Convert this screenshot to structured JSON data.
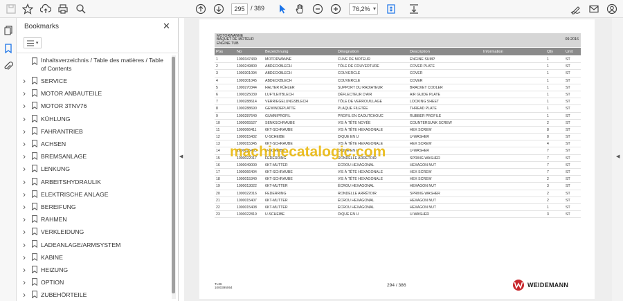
{
  "toolbar": {
    "page_current": "295",
    "page_total": "/ 389",
    "zoom": "76,2%",
    "icons": [
      "save-icon",
      "bookmark-star-icon",
      "upload-icon",
      "print-icon",
      "zoom-search-icon",
      "page-up-icon",
      "page-down-icon",
      "select-cursor-icon",
      "hand-icon",
      "zoom-out-icon",
      "zoom-in-icon",
      "fit-page-icon",
      "scroll-mode-icon",
      "sign-icon",
      "mail-icon",
      "account-icon"
    ]
  },
  "panel": {
    "title": "Bookmarks",
    "close": "✕",
    "bookmarks": [
      {
        "label": "Inhaltsverzeichnis / Table des matières / Table of Contents",
        "expandable": false
      },
      {
        "label": "SERVICE",
        "expandable": true
      },
      {
        "label": "MOTOR ANBAUTEILE",
        "expandable": true
      },
      {
        "label": "MOTOR 3TNV76",
        "expandable": true
      },
      {
        "label": "KÜHLUNG",
        "expandable": true
      },
      {
        "label": "FAHRANTRIEB",
        "expandable": true
      },
      {
        "label": "ACHSEN",
        "expandable": true
      },
      {
        "label": "BREMSANLAGE",
        "expandable": true
      },
      {
        "label": "LENKUNG",
        "expandable": true
      },
      {
        "label": "ARBEITSHYDRAULIK",
        "expandable": true
      },
      {
        "label": "ELEKTRISCHE ANLAGE",
        "expandable": true
      },
      {
        "label": "BEREIFUNG",
        "expandable": true
      },
      {
        "label": "RAHMEN",
        "expandable": true
      },
      {
        "label": "VERKLEIDUNG",
        "expandable": true
      },
      {
        "label": "LADEANLAGE/ARMSYSTEM",
        "expandable": true
      },
      {
        "label": "KABINE",
        "expandable": true
      },
      {
        "label": "HEIZUNG",
        "expandable": true
      },
      {
        "label": "OPTION",
        "expandable": true
      },
      {
        "label": "ZUBEHÖRTEILE",
        "expandable": true
      }
    ]
  },
  "document": {
    "header_lines": [
      "MOTORWANNE",
      "BAQUET DE MOTEUR",
      "ENGINE TUB"
    ],
    "header_date": "09.2016",
    "columns": [
      "Pos",
      "No",
      "Bezeichnung",
      "Désignation",
      "Description",
      "Information",
      "Qty",
      "Unit"
    ],
    "rows": [
      [
        "1",
        "1000347439",
        "MOTORWANNE",
        "CUVE DE MOTEUR",
        "ENGINE SUMP",
        "",
        "1",
        "ST"
      ],
      [
        "2",
        "1000249800",
        "ABDECKBLECH",
        "TÔLE DE COUVERTURE",
        "COVER PLATE",
        "",
        "1",
        "ST"
      ],
      [
        "3",
        "1000301094",
        "ABDECKBLECH",
        "COUVERCLE",
        "COVER",
        "",
        "1",
        "ST"
      ],
      [
        "4",
        "1000301045",
        "ABDECKBLECH",
        "COUVERCLE",
        "COVER",
        "",
        "1",
        "ST"
      ],
      [
        "5",
        "1000270344",
        "HALTER KÜHLER",
        "SUPPORT DU RADIATEUR",
        "BRACKET COOLER",
        "",
        "1",
        "ST"
      ],
      [
        "6",
        "1000325039",
        "LUFTLEITBLECH",
        "DÉFLECTEUR D'AIR",
        "AIR GUIDE PLATE",
        "",
        "1",
        "ST"
      ],
      [
        "7",
        "1000288614",
        "VERRIEGELUNGSBLECH",
        "TÔLE DE VERROUILLAGE",
        "LOCKING SHEET",
        "",
        "1",
        "ST"
      ],
      [
        "8",
        "1000288690",
        "GEWINDEPLATTE",
        "PLAQUE FILETÉE",
        "THREAD PLATE",
        "",
        "1",
        "ST"
      ],
      [
        "9",
        "1000287640",
        "GUMMIPROFIL",
        "PROFIL EN CAOUTCHOUC",
        "RUBBER PROFILE",
        "",
        "1",
        "ST"
      ],
      [
        "10",
        "1000065527",
        "SENKSCHRAUBE",
        "VIS À TÊTE NOYÉE",
        "COUNTERSUNK SCREW",
        "",
        "2",
        "ST"
      ],
      [
        "11",
        "1000066411",
        "6KT-SCHRAUBE",
        "VIS À TÊTE HEXAGONALE",
        "HEX SCREW",
        "",
        "8",
        "ST"
      ],
      [
        "12",
        "1000015432",
        "U-SCHEIBE",
        "DIQUE EN U",
        "U-WASHER",
        "",
        "8",
        "ST"
      ],
      [
        "13",
        "1000015345",
        "6KT-SCHRAUBE",
        "VIS À TÊTE HEXAGONALE",
        "HEX SCREW",
        "",
        "4",
        "ST"
      ],
      [
        "14",
        "1000015403",
        "U-SCHEIBE",
        "DIQUE EN U",
        "U-WASHER",
        "",
        "7",
        "ST"
      ],
      [
        "15",
        "1000022017",
        "FEDERRING",
        "RONDELLE ARRÊTOIR",
        "SPRING WASHER",
        "",
        "7",
        "ST"
      ],
      [
        "16",
        "1000049000",
        "6KT-MUTTER",
        "ÉCROU HEXAGONAL",
        "HEXAGON NUT",
        "",
        "7",
        "ST"
      ],
      [
        "17",
        "1000066404",
        "6KT-SCHRAUBE",
        "VIS À TÊTE HEXAGONALE",
        "HEX SCREW",
        "",
        "7",
        "ST"
      ],
      [
        "18",
        "1000015340",
        "6KT-SCHRAUBE",
        "VIS À TÊTE HEXAGONALE",
        "HEX SCREW",
        "",
        "2",
        "ST"
      ],
      [
        "19",
        "1000013022",
        "6KT-MUTTER",
        "ÉCROU HEXAGONAL",
        "HEXAGON NUT",
        "",
        "3",
        "ST"
      ],
      [
        "20",
        "1000022016",
        "FEDERRING",
        "RONDELLE ARRÊTOIR",
        "SPRING WASHER",
        "",
        "2",
        "ST"
      ],
      [
        "21",
        "1000015407",
        "6KT-MUTTER",
        "ÉCROU HEXAGONAL",
        "HEXAGON NUT",
        "",
        "2",
        "ST"
      ],
      [
        "22",
        "1000015408",
        "6KT-MUTTER",
        "ÉCROU HEXAGONAL",
        "HEXAGON NUT",
        "",
        "1",
        "ST"
      ],
      [
        "23",
        "1000022819",
        "U-SCHEIBE",
        "DIQUE EN U",
        "U-WASHER",
        "",
        "3",
        "ST"
      ]
    ],
    "footer_model": "TL36",
    "footer_number": "1000395064",
    "footer_page": "294 / 386",
    "brand": "WEIDEMANN",
    "watermark": "machinecatalogic.com"
  },
  "colors": {
    "brand_red": "#c8282e",
    "accent_blue": "#1a73e8",
    "watermark": "#e8b400"
  }
}
